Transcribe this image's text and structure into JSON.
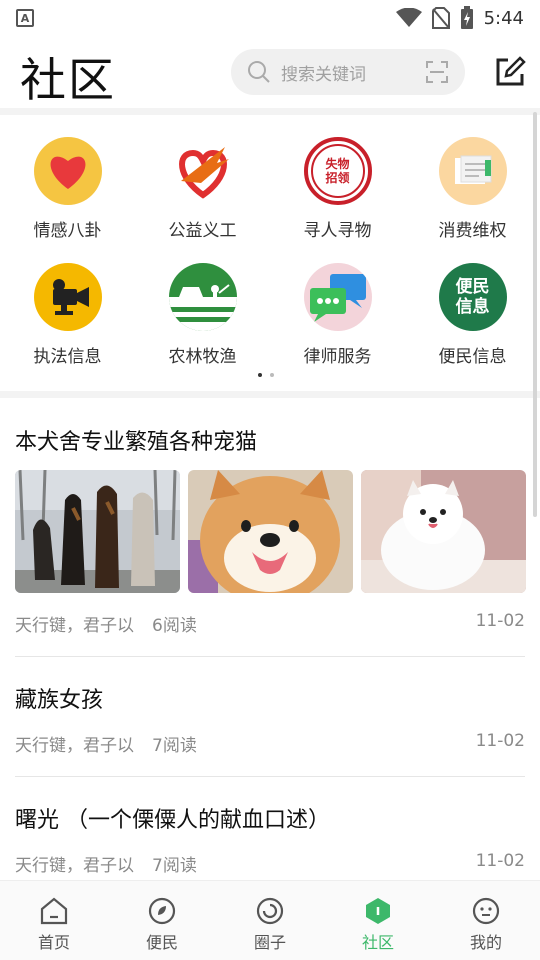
{
  "status_bar": {
    "time": "5:44",
    "left_icon_letter": "A"
  },
  "header": {
    "title": "社区",
    "search_placeholder": "搜索关键词"
  },
  "categories": [
    {
      "label": "情感八卦",
      "icon": "heart-icon",
      "color": "#f5c542"
    },
    {
      "label": "公益义工",
      "icon": "charity-icon",
      "color": "#ffffff"
    },
    {
      "label": "寻人寻物",
      "icon": "lost-found-icon",
      "color": "#c8202a"
    },
    {
      "label": "消费维权",
      "icon": "consumer-rights-icon",
      "color": "#fbd7a0"
    },
    {
      "label": "执法信息",
      "icon": "video-camera-icon",
      "color": "#f5b800"
    },
    {
      "label": "农林牧渔",
      "icon": "farm-icon",
      "color": "#2f8f3e"
    },
    {
      "label": "律师服务",
      "icon": "chat-bubbles-icon",
      "color": "#f3d4da"
    },
    {
      "label": "便民信息",
      "icon": "convenience-icon",
      "color": "#1f7a4a"
    }
  ],
  "grid_icon_texts": {
    "lost_found": "失物招领",
    "convenience_line1": "便民",
    "convenience_line2": "信息"
  },
  "pager": {
    "total": 2,
    "active": 1
  },
  "posts": [
    {
      "title": "本犬舍专业繁殖各种宠猫",
      "author": "天行键，君子以",
      "reads": "6阅读",
      "date": "11-02"
    },
    {
      "title": "藏族女孩",
      "author": "天行键，君子以",
      "reads": "7阅读",
      "date": "11-02"
    },
    {
      "title": "曙光 （一个傈僳人的献血口述）",
      "author": "天行键，君子以",
      "reads": "7阅读",
      "date": "11-02"
    }
  ],
  "bottom_nav": [
    {
      "label": "首页",
      "icon": "home-icon"
    },
    {
      "label": "便民",
      "icon": "convenience-nav-icon"
    },
    {
      "label": "圈子",
      "icon": "circle-icon"
    },
    {
      "label": "社区",
      "icon": "community-icon",
      "active": true
    },
    {
      "label": "我的",
      "icon": "profile-icon"
    }
  ],
  "colors": {
    "accent": "#3db86a",
    "meta_text": "#8a8a8a"
  }
}
